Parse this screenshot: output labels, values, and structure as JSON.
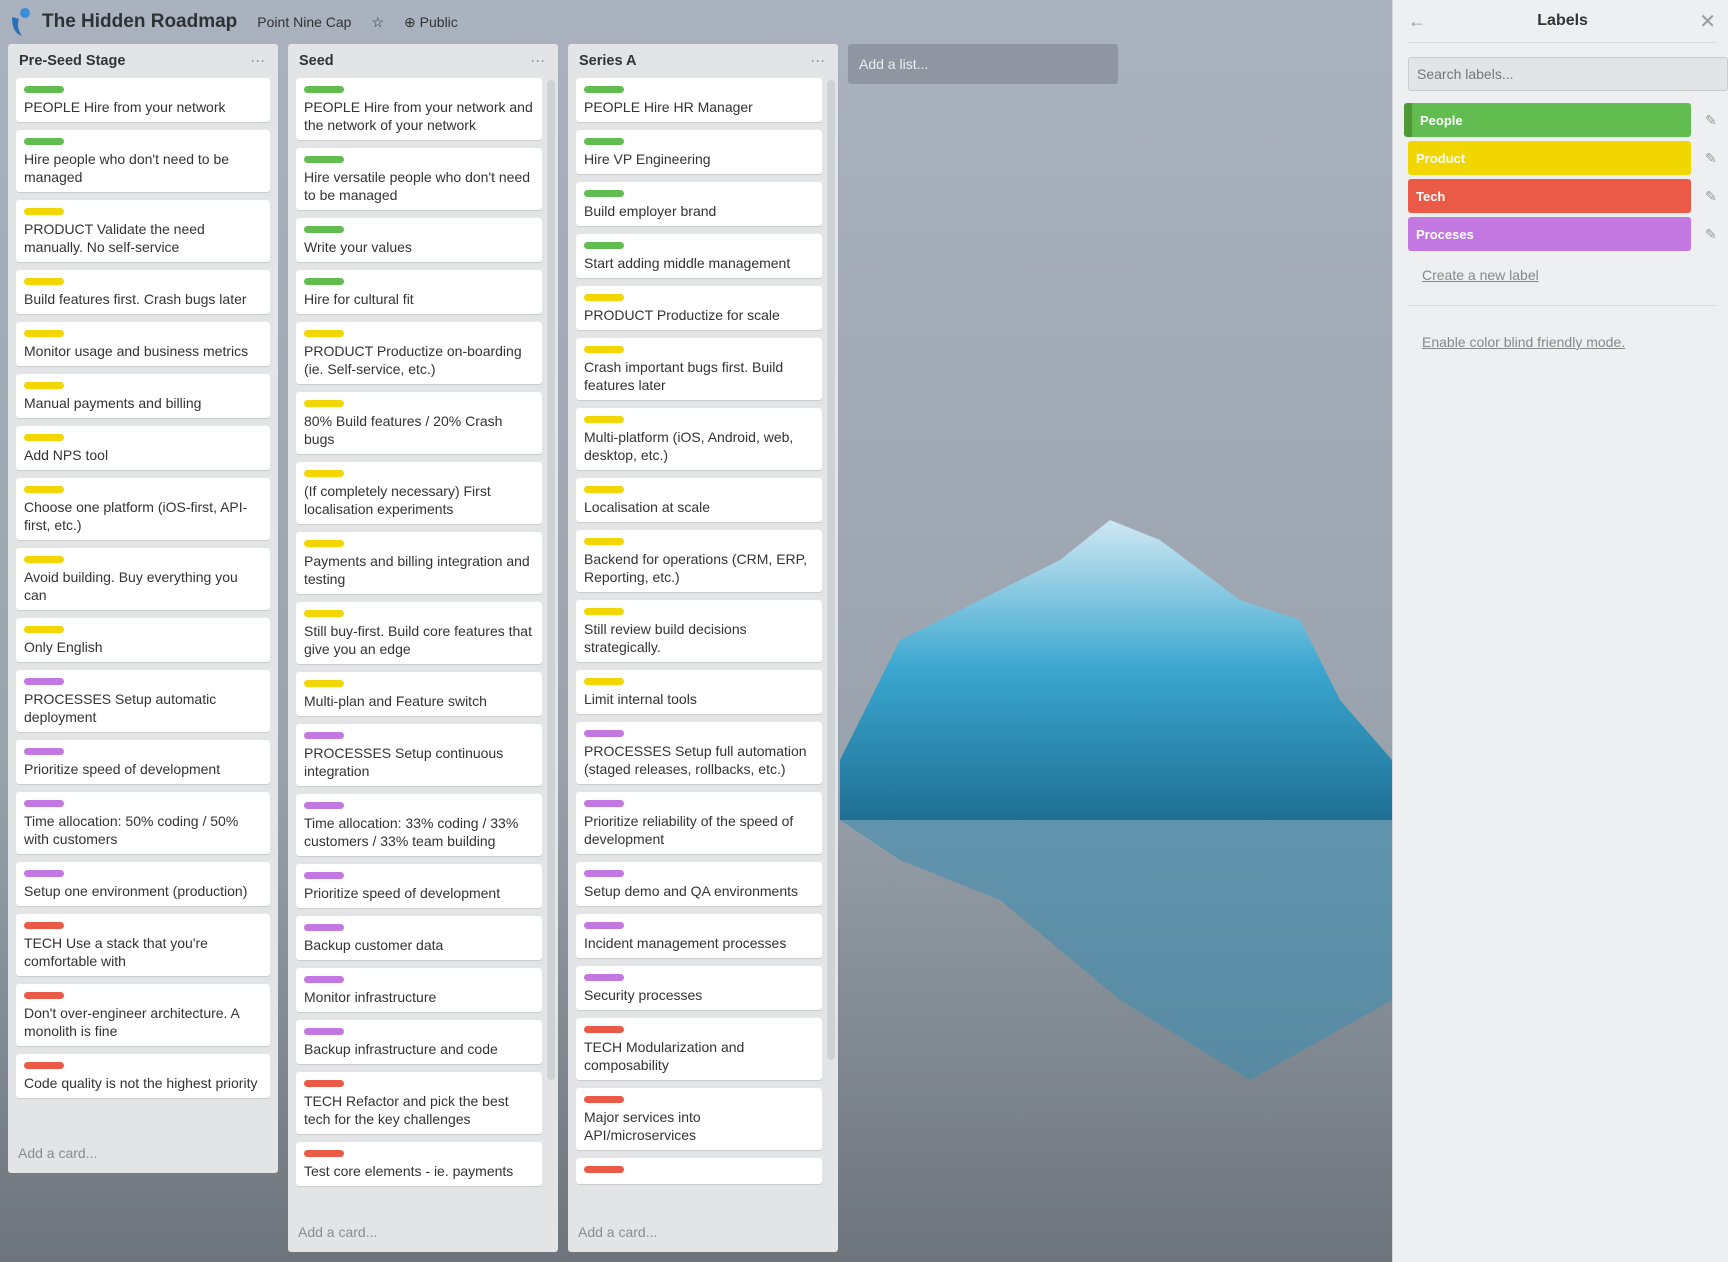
{
  "header": {
    "title": "The Hidden Roadmap",
    "team": "Point Nine Cap",
    "visibility": "Public"
  },
  "colors": {
    "green": "#61bd4f",
    "yellow": "#f2d600",
    "red": "#eb5a46",
    "purple": "#c377e0"
  },
  "lists": [
    {
      "name": "Pre-Seed Stage",
      "add_card": "Add a card...",
      "cards": [
        {
          "label": "green",
          "text": "PEOPLE Hire from your network"
        },
        {
          "label": "green",
          "text": "Hire people who don't need to be managed"
        },
        {
          "label": "yellow",
          "text": "PRODUCT Validate the need manually. No self-service"
        },
        {
          "label": "yellow",
          "text": "Build features first. Crash bugs later"
        },
        {
          "label": "yellow",
          "text": "Monitor usage and business metrics"
        },
        {
          "label": "yellow",
          "text": "Manual payments and billing"
        },
        {
          "label": "yellow",
          "text": "Add NPS tool"
        },
        {
          "label": "yellow",
          "text": "Choose one platform (iOS-first, API-first, etc.)"
        },
        {
          "label": "yellow",
          "text": "Avoid building. Buy everything you can"
        },
        {
          "label": "yellow",
          "text": "Only English"
        },
        {
          "label": "purple",
          "text": "PROCESSES Setup automatic deployment"
        },
        {
          "label": "purple",
          "text": "Prioritize speed of development"
        },
        {
          "label": "purple",
          "text": "Time allocation: 50% coding / 50% with customers"
        },
        {
          "label": "purple",
          "text": "Setup one environment (production)"
        },
        {
          "label": "red",
          "text": "TECH Use a stack that you're comfortable with"
        },
        {
          "label": "red",
          "text": "Don't over-engineer architecture. A monolith is fine"
        },
        {
          "label": "red",
          "text": "Code quality is not the highest priority"
        }
      ]
    },
    {
      "name": "Seed",
      "add_card": "Add a card...",
      "cards": [
        {
          "label": "green",
          "text": "PEOPLE Hire from your network and the network of your network"
        },
        {
          "label": "green",
          "text": "Hire versatile people who don't need to be managed"
        },
        {
          "label": "green",
          "text": "Write your values"
        },
        {
          "label": "green",
          "text": "Hire for cultural fit"
        },
        {
          "label": "yellow",
          "text": "PRODUCT Productize on-boarding (ie. Self-service, etc.)"
        },
        {
          "label": "yellow",
          "text": "80% Build features / 20% Crash bugs"
        },
        {
          "label": "yellow",
          "text": "(If completely necessary) First localisation experiments"
        },
        {
          "label": "yellow",
          "text": "Payments and billing integration and testing"
        },
        {
          "label": "yellow",
          "text": "Still buy-first. Build core features that give you an edge"
        },
        {
          "label": "yellow",
          "text": "Multi-plan and Feature switch"
        },
        {
          "label": "purple",
          "text": "PROCESSES Setup continuous integration"
        },
        {
          "label": "purple",
          "text": "Time allocation: 33% coding / 33% customers / 33% team building"
        },
        {
          "label": "purple",
          "text": "Prioritize speed of development"
        },
        {
          "label": "purple",
          "text": "Backup customer data"
        },
        {
          "label": "purple",
          "text": "Monitor infrastructure"
        },
        {
          "label": "purple",
          "text": "Backup infrastructure and code"
        },
        {
          "label": "red",
          "text": "TECH Refactor and pick the best tech for the key challenges"
        },
        {
          "label": "red",
          "text": "Test core elements - ie. payments"
        }
      ]
    },
    {
      "name": "Series A",
      "add_card": "Add a card...",
      "cards": [
        {
          "label": "green",
          "text": "PEOPLE Hire HR Manager"
        },
        {
          "label": "green",
          "text": "Hire VP Engineering"
        },
        {
          "label": "green",
          "text": "Build employer brand"
        },
        {
          "label": "green",
          "text": "Start adding middle management"
        },
        {
          "label": "yellow",
          "text": "PRODUCT Productize for scale"
        },
        {
          "label": "yellow",
          "text": "Crash important bugs first. Build features later"
        },
        {
          "label": "yellow",
          "text": "Multi-platform (iOS, Android, web, desktop, etc.)"
        },
        {
          "label": "yellow",
          "text": "Localisation at scale"
        },
        {
          "label": "yellow",
          "text": "Backend for operations (CRM, ERP, Reporting, etc.)"
        },
        {
          "label": "yellow",
          "text": "Still review build decisions strategically."
        },
        {
          "label": "yellow",
          "text": "Limit internal tools"
        },
        {
          "label": "purple",
          "text": "PROCESSES Setup full automation (staged releases, rollbacks, etc.)"
        },
        {
          "label": "purple",
          "text": "Prioritize reliability of the speed of development"
        },
        {
          "label": "purple",
          "text": "Setup demo and QA environments"
        },
        {
          "label": "purple",
          "text": "Incident management processes"
        },
        {
          "label": "purple",
          "text": "Security processes"
        },
        {
          "label": "red",
          "text": "TECH Modularization and composability"
        },
        {
          "label": "red",
          "text": "Major services into API/microservices"
        },
        {
          "label": "red",
          "text": ""
        }
      ]
    }
  ],
  "add_list": "Add a list...",
  "sidebar": {
    "title": "Labels",
    "search_placeholder": "Search labels...",
    "labels": [
      {
        "name": "People",
        "color": "#61bd4f"
      },
      {
        "name": "Product",
        "color": "#f2d600"
      },
      {
        "name": "Tech",
        "color": "#eb5a46"
      },
      {
        "name": "Proceses",
        "color": "#c377e0"
      }
    ],
    "create_label": "Create a new label",
    "color_blind": "Enable color blind friendly mode."
  }
}
